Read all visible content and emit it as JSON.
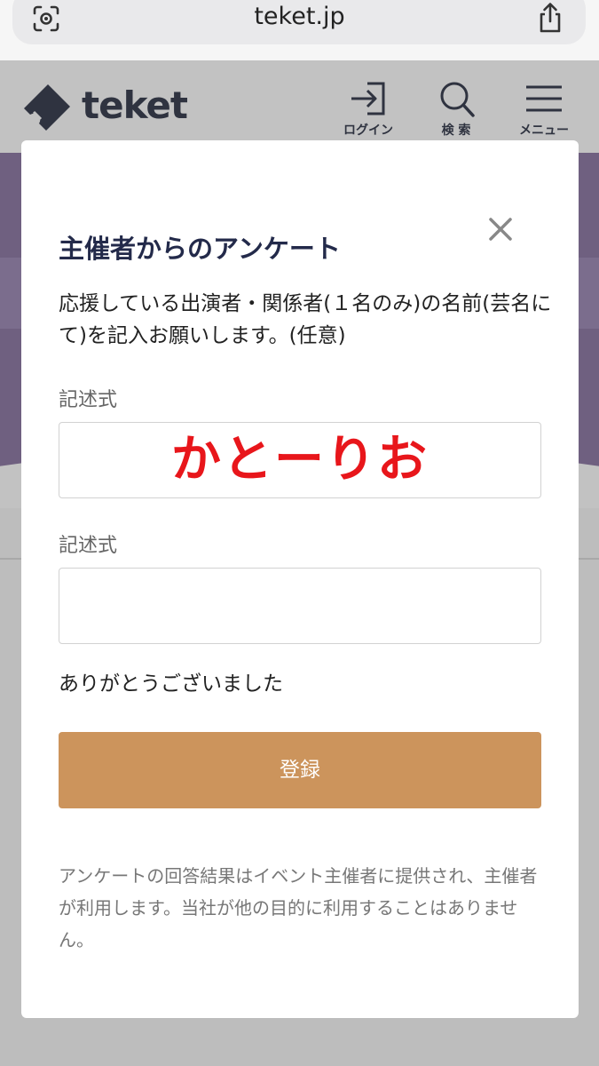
{
  "browser": {
    "url": "teket.jp",
    "icons": {
      "lens": "lens-icon",
      "share": "share-icon"
    }
  },
  "site": {
    "brand": "teket",
    "nav": [
      {
        "label": "ログイン",
        "icon": "login-icon"
      },
      {
        "label": "検 索",
        "icon": "search-icon"
      },
      {
        "label": "メニュー",
        "icon": "menu-icon"
      }
    ],
    "colors": {
      "hero": "#6f6080",
      "header_text": "#2f3340"
    }
  },
  "modal": {
    "title": "主催者からのアンケート",
    "question": "応援している出演者・関係者(１名のみ)の名前(芸名にて)を記入お願いします。(任意)",
    "fields": [
      {
        "label": "記述式",
        "value": ""
      },
      {
        "label": "記述式",
        "value": ""
      }
    ],
    "overlay_text": "かとーりお",
    "thanks": "ありがとうございました",
    "submit_label": "登録",
    "disclaimer": "アンケートの回答結果はイベント主催者に提供され、主催者が利用します。当社が他の目的に利用することはありません。",
    "colors": {
      "submit": "#cc945c",
      "title": "#232a4a",
      "overlay": "#e8161b"
    }
  }
}
